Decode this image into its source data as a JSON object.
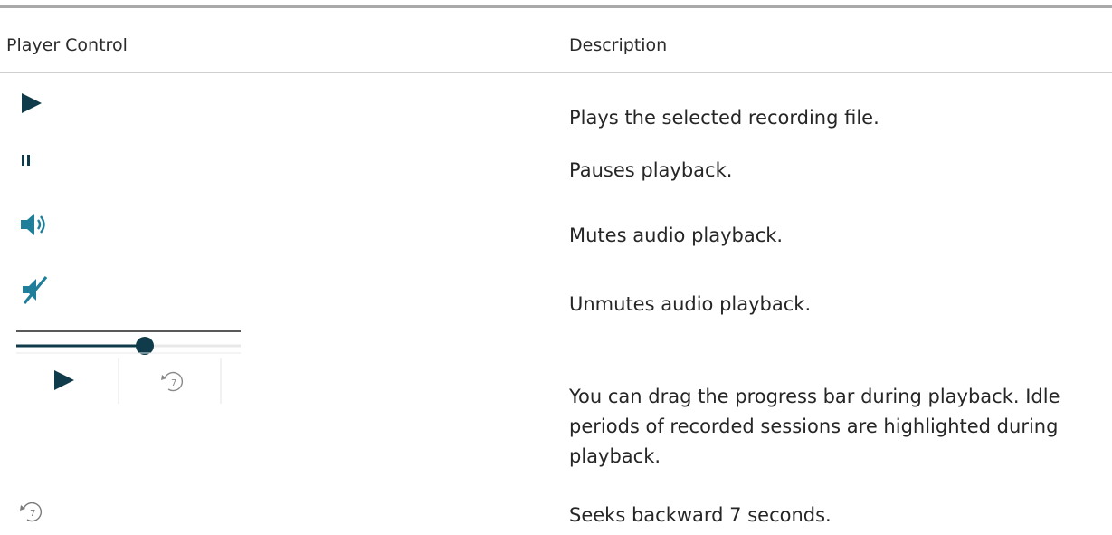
{
  "table": {
    "headers": {
      "control": "Player Control",
      "description": "Description"
    },
    "rows": [
      {
        "icon": "play-icon",
        "description": "Plays the selected recording file."
      },
      {
        "icon": "pause-icon",
        "description": "Pauses playback."
      },
      {
        "icon": "volume-icon",
        "description": "Mutes audio playback."
      },
      {
        "icon": "muted-volume-icon",
        "description": "Unmutes audio playback."
      },
      {
        "icon": "progress-bar-icon",
        "description": "You can drag the progress bar during playback. Idle periods of recorded sessions are highlighted during playback."
      },
      {
        "icon": "seek-back-7-icon",
        "description": "Seeks backward 7 seconds."
      }
    ]
  },
  "seek_label": "7",
  "colors": {
    "icon_dark": "#0f3b4a",
    "icon_teal": "#1f7f9a",
    "rule": "#a9a9a9"
  }
}
